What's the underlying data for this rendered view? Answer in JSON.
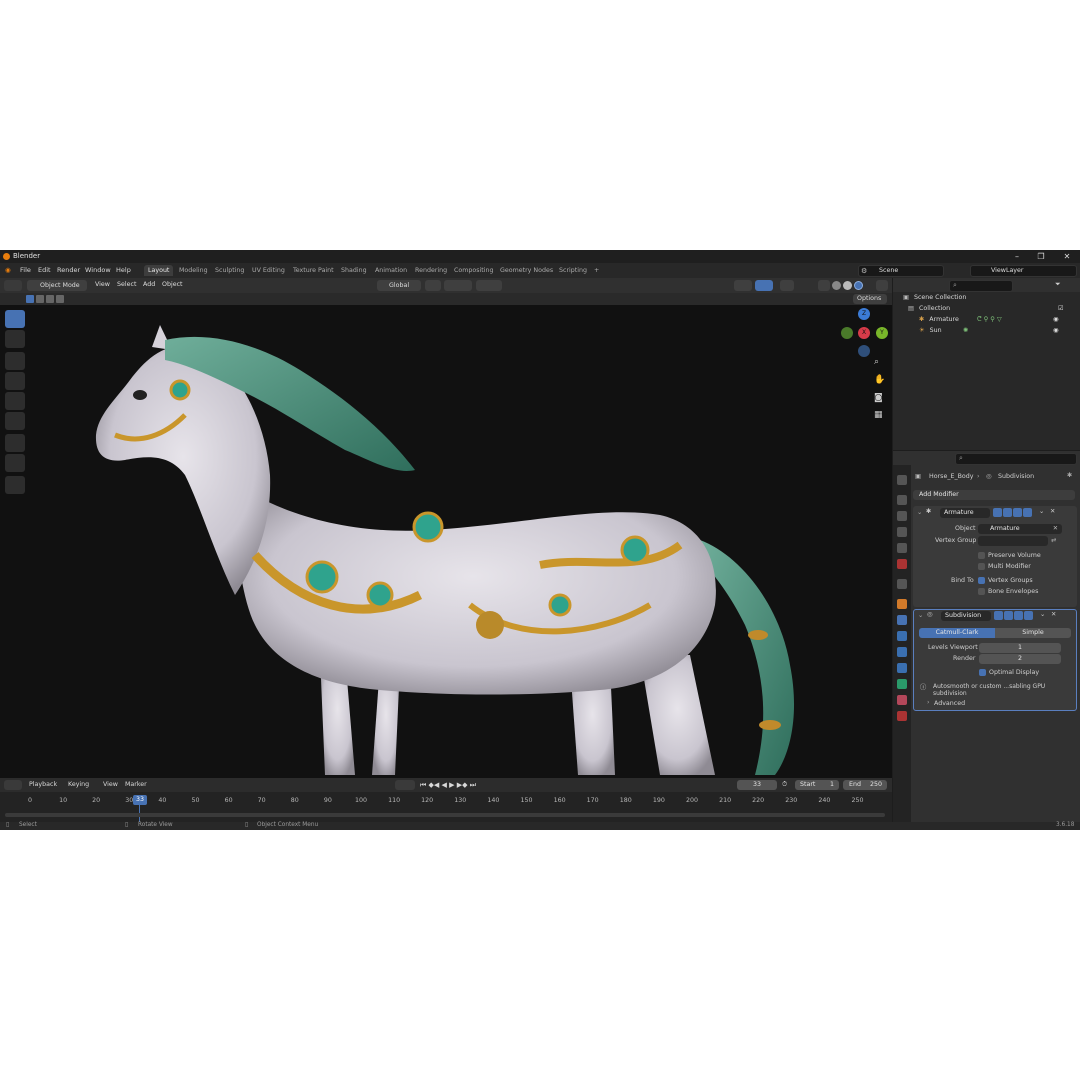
{
  "app": {
    "title": "Blender",
    "version": "3.6.18"
  },
  "menu": [
    "File",
    "Edit",
    "Render",
    "Window",
    "Help"
  ],
  "workspaces": [
    "Layout",
    "Modeling",
    "Sculpting",
    "UV Editing",
    "Texture Paint",
    "Shading",
    "Animation",
    "Rendering",
    "Compositing",
    "Geometry Nodes",
    "Scripting"
  ],
  "workspace_add": "+",
  "scene": {
    "scene_name": "Scene",
    "view_layer": "ViewLayer"
  },
  "viewport_header": {
    "mode": "Object Mode",
    "menus": [
      "View",
      "Select",
      "Add",
      "Object"
    ],
    "transform_orientation": "Global",
    "options_label": "Options"
  },
  "outliner": {
    "root": "Scene Collection",
    "collection": "Collection",
    "items": [
      "Armature",
      "Sun"
    ]
  },
  "properties": {
    "breadcrumb": {
      "object": "Horse_E_Body",
      "modifier": "Subdivision"
    },
    "add_modifier": "Add Modifier",
    "armature_modifier": {
      "name": "Armature",
      "object_label": "Object",
      "object_value": "Armature",
      "vertex_group_label": "Vertex Group",
      "preserve_volume": "Preserve Volume",
      "multi_modifier": "Multi Modifier",
      "bind_to_label": "Bind To",
      "vertex_groups": "Vertex Groups",
      "bone_envelopes": "Bone Envelopes"
    },
    "subdivision_modifier": {
      "name": "Subdivision",
      "type_catmull": "Catmull-Clark",
      "type_simple": "Simple",
      "levels_viewport_label": "Levels Viewport",
      "levels_viewport": "1",
      "render_label": "Render",
      "render": "2",
      "optimal_display": "Optimal Display",
      "info": "Autosmooth or custom ...sabling GPU subdivision",
      "advanced": "Advanced"
    }
  },
  "timeline": {
    "menus": [
      "Playback",
      "Keying",
      "View",
      "Marker"
    ],
    "current_frame": "33",
    "start_label": "Start",
    "start": "1",
    "end_label": "End",
    "end": "250",
    "ticks": [
      "0",
      "10",
      "20",
      "30",
      "40",
      "50",
      "60",
      "70",
      "80",
      "90",
      "100",
      "110",
      "120",
      "130",
      "140",
      "150",
      "160",
      "170",
      "180",
      "190",
      "200",
      "210",
      "220",
      "230",
      "240",
      "250"
    ]
  },
  "statusbar": {
    "select": "Select",
    "rotate": "Rotate View",
    "context": "Object Context Menu"
  },
  "nav_gizmo": {
    "x": "X",
    "y": "Y",
    "z": "Z"
  },
  "colors": {
    "accent": "#4772b3",
    "viewport_bg": "#111111",
    "panel_bg": "#303030"
  }
}
